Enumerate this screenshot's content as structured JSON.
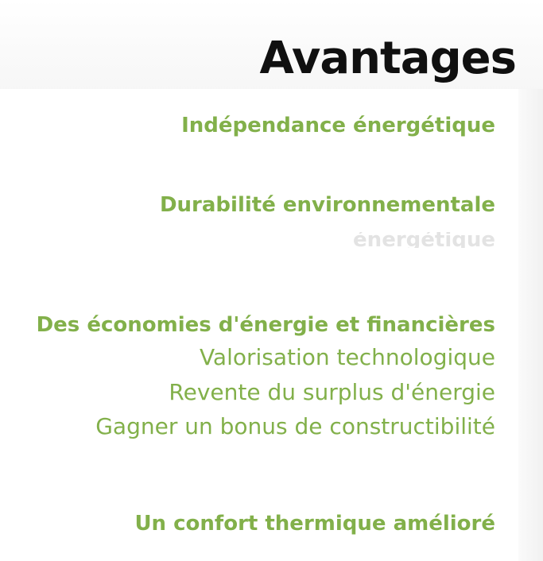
{
  "page": {
    "title": "Avantages"
  },
  "advantages": [
    {
      "label": "Indépendance énergétique"
    },
    {
      "label": "Durabilité environnementale"
    },
    {
      "label": "Des économies d'énergie et financières",
      "sub_items": [
        "Valorisation technologique",
        "Revente du surplus d'énergie",
        "Gagner un bonus de constructibilité"
      ]
    },
    {
      "label": "Un confort thermique amélioré"
    }
  ],
  "ghost_text": "énergétique",
  "colors": {
    "accent_green": "#82b04a",
    "title": "#101010",
    "background": "#ffffff"
  }
}
